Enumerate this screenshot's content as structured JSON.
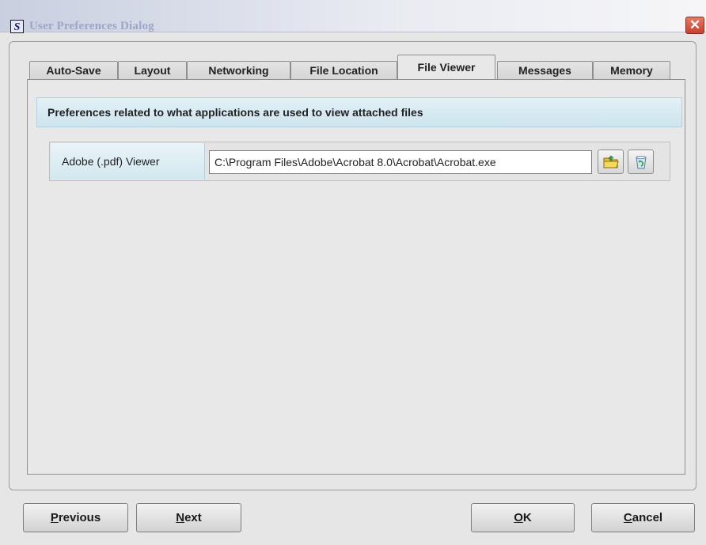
{
  "window": {
    "title": "User Preferences Dialog",
    "app_icon_letter": "S",
    "close_glyph": "✕"
  },
  "tabs": [
    {
      "label": "Auto-Save",
      "active": false
    },
    {
      "label": "Layout",
      "active": false
    },
    {
      "label": "Networking",
      "active": false
    },
    {
      "label": "File Location",
      "active": false
    },
    {
      "label": "File Viewer",
      "active": true
    },
    {
      "label": "Messages",
      "active": false
    },
    {
      "label": "Memory",
      "active": false
    }
  ],
  "panel": {
    "header": "Preferences related to what applications are used to view attached files",
    "rows": [
      {
        "label": "Adobe (.pdf) Viewer",
        "value": "C:\\Program Files\\Adobe\\Acrobat 8.0\\Acrobat\\Acrobat.exe",
        "browse_icon": "folder-icon",
        "clear_icon": "recycle-bin-icon"
      }
    ]
  },
  "buttons": {
    "previous": {
      "mnemonic": "P",
      "rest": "revious"
    },
    "next": {
      "mnemonic": "N",
      "rest": "ext"
    },
    "ok": {
      "mnemonic": "O",
      "rest": "K"
    },
    "cancel": {
      "mnemonic": "C",
      "rest": "ancel"
    }
  },
  "colors": {
    "title_text": "#9ea6c7",
    "header_strip": "#cde5ef",
    "close_button": "#c8402b"
  }
}
